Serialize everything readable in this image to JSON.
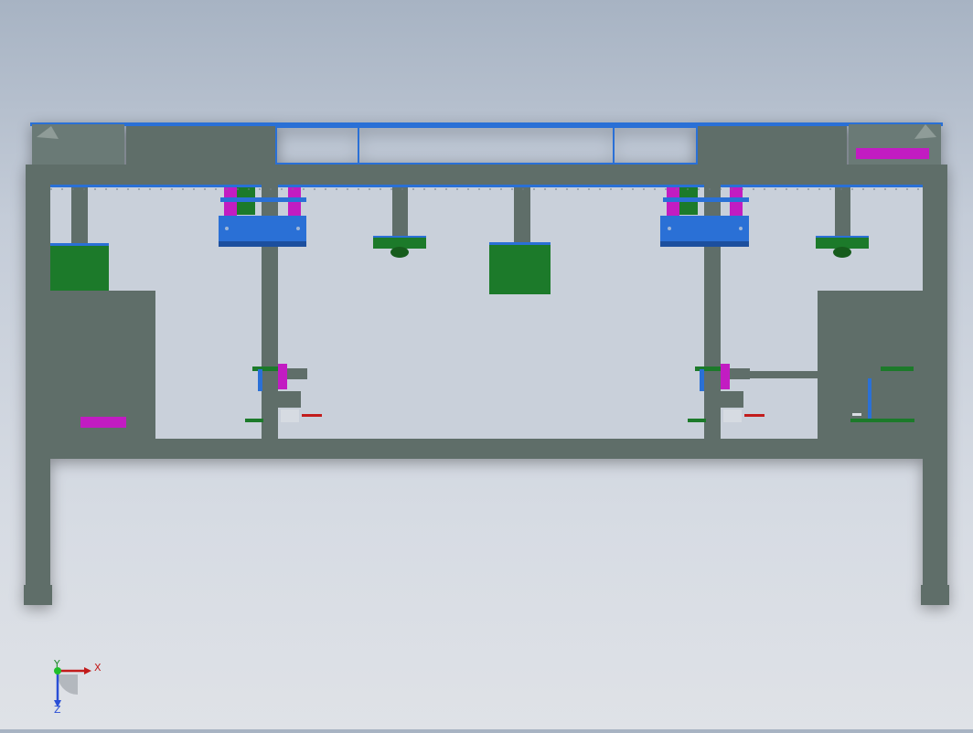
{
  "viewport": {
    "background_top": "#a7b3c3",
    "background_bottom": "#dfe2e7"
  },
  "colors": {
    "frame": "#5e6e69",
    "frame_dark": "#4f5d59",
    "blue": "#2a6fd6",
    "blue_dark": "#1d4f9e",
    "green": "#1f7a2a",
    "green_dark": "#155c1e",
    "magenta": "#c21cc2",
    "red": "#c21b1b"
  },
  "triad": {
    "x_label": "X",
    "y_label": "Y",
    "z_label": "Z"
  }
}
